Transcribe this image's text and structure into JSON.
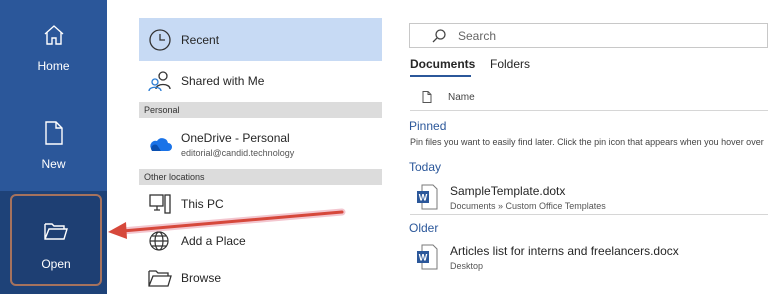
{
  "nav": {
    "home_label": "Home",
    "new_label": "New",
    "open_label": "Open"
  },
  "places": {
    "recent": "Recent",
    "shared": "Shared with Me",
    "personal_header": "Personal",
    "onedrive_title": "OneDrive - Personal",
    "onedrive_email": "editorial@candid.technology",
    "other_header": "Other locations",
    "this_pc": "This PC",
    "add_place": "Add a Place",
    "browse": "Browse"
  },
  "search": {
    "placeholder": "Search"
  },
  "tabs": {
    "documents": "Documents",
    "folders": "Folders"
  },
  "list": {
    "name_column": "Name",
    "pinned_header": "Pinned",
    "pinned_note": "Pin files you want to easily find later. Click the pin icon that appears when you hover over",
    "today_header": "Today",
    "older_header": "Older",
    "files": [
      {
        "name": "SampleTemplate.dotx",
        "path": "Documents » Custom Office Templates"
      },
      {
        "name": "Articles list for interns and freelancers.docx",
        "path": "Desktop"
      }
    ]
  },
  "colors": {
    "nav_bg": "#2b579a",
    "selected_place": "#c7daf4",
    "arrow": "#d6483b",
    "accent": "#2b579a"
  }
}
